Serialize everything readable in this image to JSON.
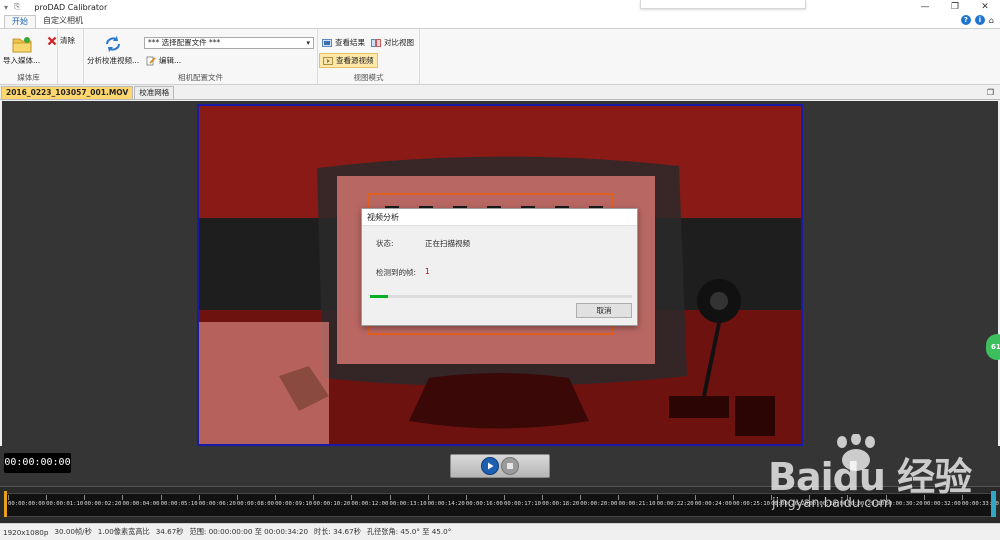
{
  "app": {
    "title": "proDAD Calibrator"
  },
  "titlebar": {
    "quick_access": [
      "▾",
      "⎘"
    ],
    "min": "—",
    "max": "❐",
    "close": "✕"
  },
  "ribbon_tabs": [
    {
      "label": "开始",
      "active": true
    },
    {
      "label": "自定义相机",
      "active": false
    }
  ],
  "help_icons": [
    "?",
    "i",
    "⌂"
  ],
  "ribbon": {
    "media": {
      "import_label": "导入媒体...",
      "clear_label": "清除",
      "group_label": "媒体库"
    },
    "profile": {
      "analyze_label": "分析校准视频...",
      "combo_value": "*** 选择配置文件 ***",
      "edit_label": "编辑...",
      "group_label": "相机配置文件"
    },
    "view": {
      "results_label": "查看结果",
      "compare_label": "对比视图",
      "source_label": "查看源视频",
      "group_label": "视图模式"
    }
  },
  "doc_tabs": [
    {
      "label": "2016_0223_103057_001.MOV",
      "active": true
    },
    {
      "label": "校准网格",
      "active": false
    }
  ],
  "side_bubble": "61",
  "dialog": {
    "title": "视频分析",
    "status_label": "状态:",
    "status_value": "正在扫描视频",
    "frames_label": "检测到的帧:",
    "frames_value": "1",
    "progress": 0.07,
    "cancel_label": "取消"
  },
  "timecode": "00:00:00:00",
  "timeline_ticks": [
    "00:00:00:00",
    "00:00:01:10",
    "00:00:02:20",
    "00:00:04:00",
    "00:00:05:10",
    "00:00:06:20",
    "00:00:08:00",
    "00:00:09:10",
    "00:00:10:20",
    "00:00:12:00",
    "00:00:13:10",
    "00:00:14:20",
    "00:00:16:00",
    "00:00:17:10",
    "00:00:18:20",
    "00:00:20:00",
    "00:00:21:10",
    "00:00:22:20",
    "00:00:24:00",
    "00:00:25:10",
    "00:00:26:20",
    "00:00:28:00",
    "00:00:29:10",
    "00:00:30:20",
    "00:00:32:00",
    "00:00:33:10"
  ],
  "statusbar": {
    "resolution": "1920x1080p",
    "framerate": "30.00帧/秒",
    "aspect": "1.00像素宽高比",
    "duration_sec": "34.67秒",
    "range": "范围: 00:00:00:00 至 00:00:34:20",
    "length": "时长: 34.67秒",
    "aperture": "孔径张角: 45.0° 至 45.0°"
  },
  "watermark": {
    "brand": "Baidu 经验",
    "url": "jingyan.baidu.com"
  },
  "colors": {
    "accent": "#1e64b4",
    "video_border": "#1a1aa8",
    "progress": "#06b025",
    "highlight": "#ffd76e"
  }
}
